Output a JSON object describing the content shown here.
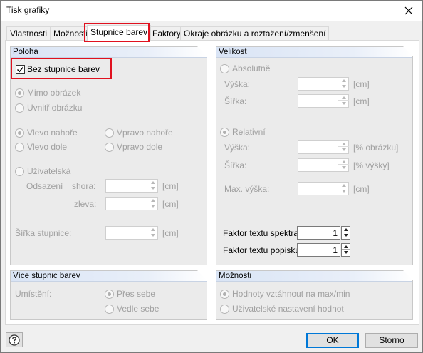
{
  "window": {
    "title": "Tisk grafiky"
  },
  "tabs": [
    {
      "label": "Vlastnosti"
    },
    {
      "label": "Možnosti"
    },
    {
      "label": "Stupnice barev",
      "active": true
    },
    {
      "label": "Faktory"
    },
    {
      "label": "Okraje obrázku a roztažení/zmenšení"
    }
  ],
  "poloha": {
    "header": "Poloha",
    "no_scale": {
      "label": "Bez stupnice barev",
      "checked": true
    },
    "mimo": "Mimo obrázek",
    "uvnitr": "Uvnitř obrázku",
    "vlevo_nahore": "Vlevo nahoře",
    "vpravo_nahore": "Vpravo nahoře",
    "vlevo_dole": "Vlevo dole",
    "vpravo_dole": "Vpravo dole",
    "uzivatelska": "Uživatelská",
    "odsazeni": "Odsazení",
    "shora": "shora:",
    "zleva": "zleva:",
    "sirka_stupnice": "Šířka stupnice:",
    "unit_cm": "[cm]"
  },
  "velikost": {
    "header": "Velikost",
    "absolutne": "Absolutně",
    "vyska": "Výška:",
    "sirka": "Šířka:",
    "unit_cm": "[cm]",
    "relativni": "Relativní",
    "unit_pct_obrazku": "[% obrázku]",
    "unit_pct_vysky": "[% výšky]",
    "max_vyska": "Max. výška:",
    "faktor_spektra": {
      "label": "Faktor textu spektra:",
      "value": "1"
    },
    "faktor_popisku": {
      "label": "Faktor textu popisku:",
      "value": "1"
    }
  },
  "vice": {
    "header": "Více stupnic barev",
    "umisteni": "Umístění:",
    "pres_sebe": "Přes sebe",
    "vedle_sebe": "Vedle sebe"
  },
  "moznosti": {
    "header": "Možnosti",
    "max_min": "Hodnoty vztáhnout na max/min",
    "uziv_nastaveni": "Uživatelské nastavení hodnot"
  },
  "buttons": {
    "ok": "OK",
    "cancel": "Storno"
  },
  "colors": {
    "highlight": "#e0111f",
    "accent": "#0078d7",
    "header_blue": "#d9e4f5"
  },
  "icons": {
    "close": "close-icon",
    "help": "help-icon",
    "check": "checkmark-icon"
  }
}
